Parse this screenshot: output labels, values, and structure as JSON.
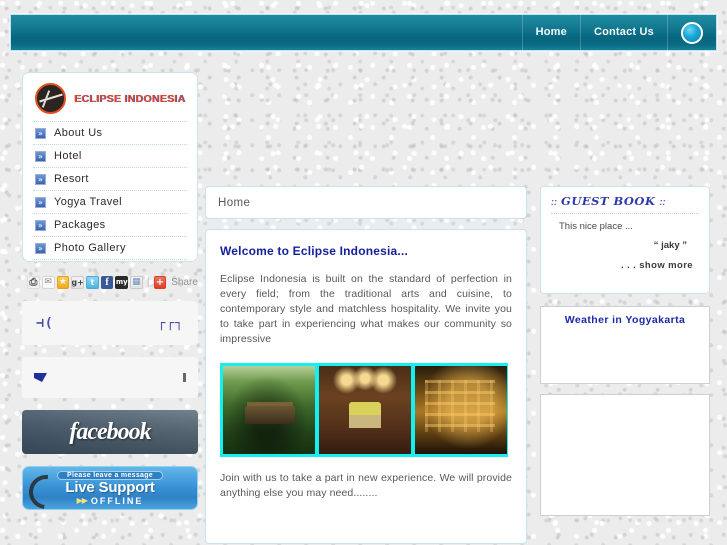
{
  "header": {
    "nav": [
      {
        "label": "Home",
        "name": "topnav-home"
      },
      {
        "label": "Contact Us",
        "name": "topnav-contact-us"
      }
    ],
    "icon": "circle-icon"
  },
  "sidebar": {
    "brand": {
      "name": "ECLIPSE INDONESIA",
      "logo_icon": "eclipse-logo-icon"
    },
    "nav_items": [
      {
        "label": "About Us",
        "bullet": "»"
      },
      {
        "label": "Hotel",
        "bullet": "»"
      },
      {
        "label": "Resort",
        "bullet": "»"
      },
      {
        "label": "Yogya Travel",
        "bullet": "»"
      },
      {
        "label": "Packages",
        "bullet": "»"
      },
      {
        "label": "Photo Gallery",
        "bullet": "»"
      }
    ],
    "share": {
      "icons": [
        {
          "name": "print-icon",
          "glyph": "⎙",
          "cls": "si-print"
        },
        {
          "name": "email-icon",
          "glyph": "✉",
          "cls": "si-mail"
        },
        {
          "name": "favorites-star-icon",
          "glyph": "★",
          "cls": "si-fav"
        },
        {
          "name": "google-plus-icon",
          "glyph": "g+",
          "cls": "si-gplus"
        },
        {
          "name": "twitter-icon",
          "glyph": "t",
          "cls": "si-twit"
        },
        {
          "name": "facebook-icon",
          "glyph": "f",
          "cls": "si-fb"
        },
        {
          "name": "myspace-icon",
          "glyph": "my",
          "cls": "si-my"
        },
        {
          "name": "more-services-icon",
          "glyph": "▦",
          "cls": "si-more"
        }
      ],
      "separator": "|",
      "plus_glyph": "+",
      "label": "Share"
    },
    "banners": {
      "hotel": {
        "left_glyph": "⊣(",
        "right_glyph": "┌┌┐",
        "name": "hotel-banner"
      },
      "agoda": {
        "name": "agoda-banner"
      },
      "facebook": {
        "word": "facebook",
        "name": "facebook-banner"
      },
      "live_support": {
        "top_label": "Please leave a message",
        "title": "Live Support",
        "arrows": "▶▶",
        "status": "OFFLINE",
        "name": "live-support-banner"
      }
    }
  },
  "main": {
    "page_title": "Home",
    "heading": "Welcome to Eclipse Indonesia...",
    "paragraph_1": "Eclipse Indonesia is built on the standard of perfection in every field; from the traditional arts and cuisine, to contemporary style and matchless hospitality. We invite you to take part in experiencing what makes our community so impressive",
    "paragraph_2": "Join with us to take a part in new experience. We will provide anything else you may need........",
    "gallery": [
      {
        "name": "gallery-image-resort-jungle",
        "alt": "Jungle resort pavilion"
      },
      {
        "name": "gallery-image-traditional-couple",
        "alt": "Couple in traditional javanese interior"
      },
      {
        "name": "gallery-image-hotel-night",
        "alt": "Hotel building illuminated at night"
      }
    ]
  },
  "right": {
    "guestbook": {
      "colon_left": "::",
      "title": "GUEST BOOK",
      "colon_right": "::",
      "message": "This nice place ...",
      "author": "“ jaky ”",
      "show_more": ". . . show more"
    },
    "weather": {
      "title": "Weather in Yogyakarta"
    }
  },
  "colors": {
    "header_teal": "#0e7189",
    "accent_blue": "#2b39ad",
    "brand_red": "#e0462a",
    "gallery_cyan": "#14f0f2",
    "panel_border": "#c6e4ec"
  }
}
